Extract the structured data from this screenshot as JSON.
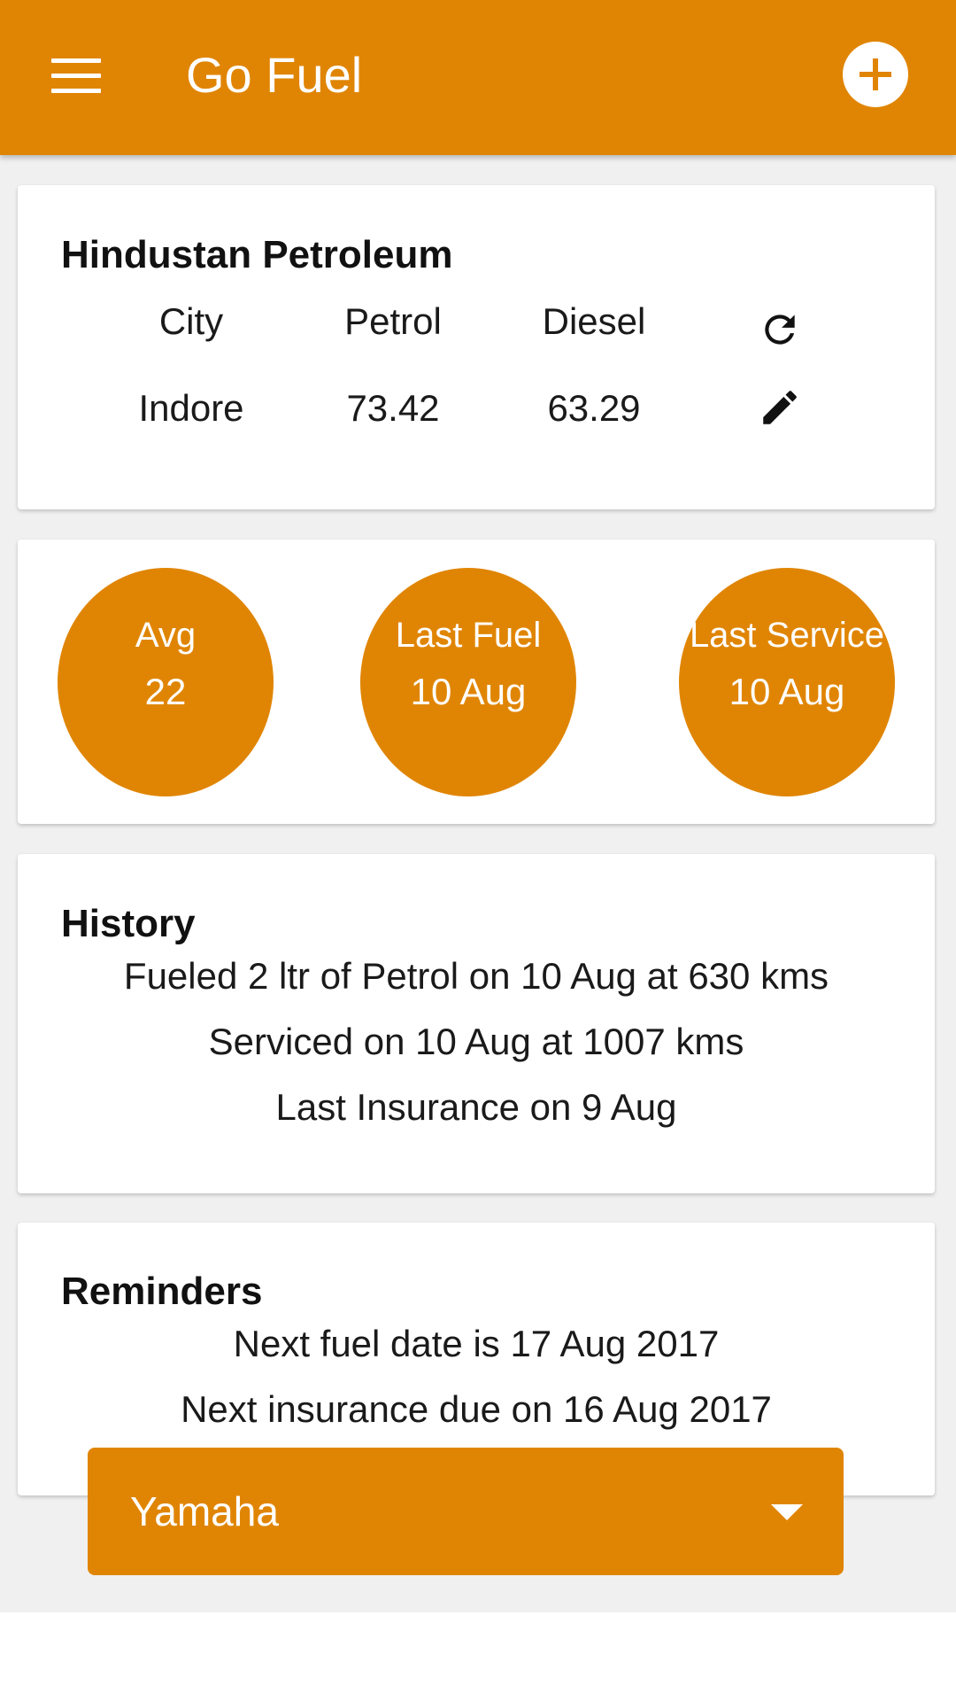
{
  "appbar": {
    "title": "Go Fuel",
    "menu_icon": "menu-icon",
    "add_icon": "add-circle-icon",
    "accent_color": "#e08503"
  },
  "prices": {
    "title": "Hindustan Petroleum",
    "headers": [
      "City",
      "Petrol",
      "Diesel"
    ],
    "values": [
      "Indore",
      "73.42",
      "63.29"
    ],
    "refresh_icon": "refresh-icon",
    "edit_icon": "pencil-icon"
  },
  "stats": [
    {
      "label": "Avg",
      "value": "22"
    },
    {
      "label": "Last Fuel",
      "value": "10 Aug"
    },
    {
      "label": "Last Service",
      "value": "10 Aug"
    }
  ],
  "history": {
    "title": "History",
    "lines": [
      "Fueled 2 ltr of Petrol on 10 Aug at 630 kms",
      "Serviced on 10 Aug at 1007 kms",
      "Last Insurance on 9 Aug"
    ]
  },
  "reminders": {
    "title": "Reminders",
    "lines": [
      "Next fuel date is 17 Aug 2017",
      "Next insurance due on 16 Aug 2017"
    ]
  },
  "vehicle_select": {
    "value": "Yamaha",
    "icon": "dropdown-caret-icon"
  }
}
